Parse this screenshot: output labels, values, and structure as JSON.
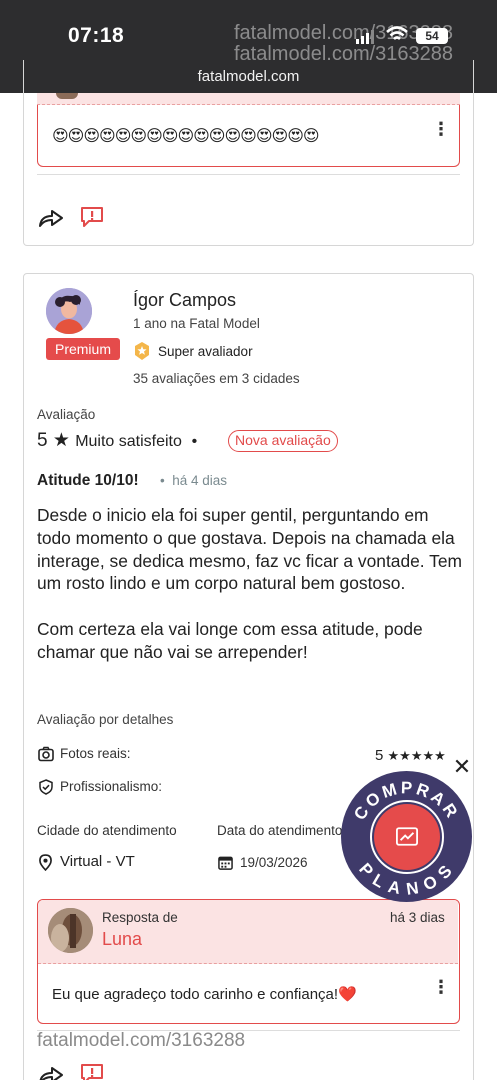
{
  "status_bar": {
    "time": "07:18",
    "url": "fatalmodel.com",
    "watermark_1": "fatalmodel.com/3163288",
    "watermark_2": "fatalmodel.com/3163288",
    "battery": "54"
  },
  "prev_review": {
    "reply_text": "😍😍😍😍😍😍😍😍😍😍😍😍😍😍😍😍😍"
  },
  "review": {
    "author": {
      "name": "Ígor Campos",
      "since": "1 ano na Fatal Model",
      "badge": "Premium",
      "title": "Super avaliador",
      "stats": "35 avaliações em 3 cidades"
    },
    "rating_label": "Avaliação",
    "rating_value": "5",
    "rating_text": "Muito satisfeito",
    "new_tag": "Nova avaliação",
    "headline": "Atitude 10/10!",
    "when": "há 4 dias",
    "body_p1": "Desde o inicio ela foi super gentil, perguntando em todo momento o que gostava. Depois na chamada ela interage, se dedica mesmo, faz vc ficar a vontade. Tem um rosto lindo e um corpo natural bem gostoso.",
    "body_p2": "Com certeza ela vai longe com essa atitude, pode chamar que não vai se arrepender!",
    "details_label": "Avaliação por detalhes",
    "details": [
      {
        "label": "Fotos reais:",
        "score": "5",
        "stars": "★★★★★"
      },
      {
        "label": "Profissionalismo:"
      }
    ],
    "city_label": "Cidade do atendimento",
    "city": "Virtual - VT",
    "date_label": "Data do atendimento",
    "date": "19/03/2026",
    "reply": {
      "label": "Resposta de",
      "name": "Luna",
      "when": "há 3 dias",
      "text": "Eu que agradeço todo carinho e confiança!❤️"
    }
  },
  "watermark_bottom": "fatalmodel.com/3163288",
  "fab": {
    "label": "COMPRAR PLANOS"
  },
  "colors": {
    "accent": "#e24b4b",
    "fab_bg": "#3f3a6a",
    "statusbar": "#2d2d2f"
  }
}
